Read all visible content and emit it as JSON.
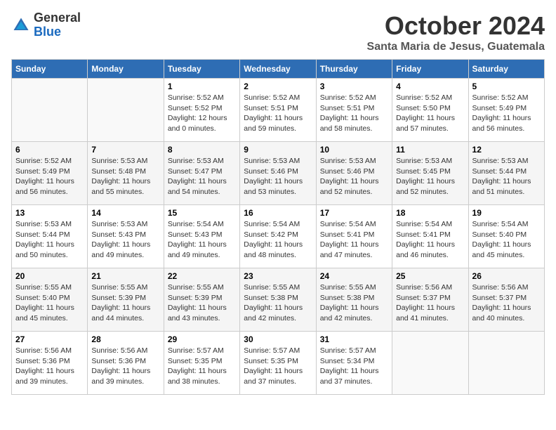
{
  "logo": {
    "general": "General",
    "blue": "Blue"
  },
  "title": "October 2024",
  "location": "Santa Maria de Jesus, Guatemala",
  "weekdays": [
    "Sunday",
    "Monday",
    "Tuesday",
    "Wednesday",
    "Thursday",
    "Friday",
    "Saturday"
  ],
  "weeks": [
    [
      {
        "day": "",
        "info": ""
      },
      {
        "day": "",
        "info": ""
      },
      {
        "day": "1",
        "info": "Sunrise: 5:52 AM\nSunset: 5:52 PM\nDaylight: 12 hours\nand 0 minutes."
      },
      {
        "day": "2",
        "info": "Sunrise: 5:52 AM\nSunset: 5:51 PM\nDaylight: 11 hours\nand 59 minutes."
      },
      {
        "day": "3",
        "info": "Sunrise: 5:52 AM\nSunset: 5:51 PM\nDaylight: 11 hours\nand 58 minutes."
      },
      {
        "day": "4",
        "info": "Sunrise: 5:52 AM\nSunset: 5:50 PM\nDaylight: 11 hours\nand 57 minutes."
      },
      {
        "day": "5",
        "info": "Sunrise: 5:52 AM\nSunset: 5:49 PM\nDaylight: 11 hours\nand 56 minutes."
      }
    ],
    [
      {
        "day": "6",
        "info": "Sunrise: 5:52 AM\nSunset: 5:49 PM\nDaylight: 11 hours\nand 56 minutes."
      },
      {
        "day": "7",
        "info": "Sunrise: 5:53 AM\nSunset: 5:48 PM\nDaylight: 11 hours\nand 55 minutes."
      },
      {
        "day": "8",
        "info": "Sunrise: 5:53 AM\nSunset: 5:47 PM\nDaylight: 11 hours\nand 54 minutes."
      },
      {
        "day": "9",
        "info": "Sunrise: 5:53 AM\nSunset: 5:46 PM\nDaylight: 11 hours\nand 53 minutes."
      },
      {
        "day": "10",
        "info": "Sunrise: 5:53 AM\nSunset: 5:46 PM\nDaylight: 11 hours\nand 52 minutes."
      },
      {
        "day": "11",
        "info": "Sunrise: 5:53 AM\nSunset: 5:45 PM\nDaylight: 11 hours\nand 52 minutes."
      },
      {
        "day": "12",
        "info": "Sunrise: 5:53 AM\nSunset: 5:44 PM\nDaylight: 11 hours\nand 51 minutes."
      }
    ],
    [
      {
        "day": "13",
        "info": "Sunrise: 5:53 AM\nSunset: 5:44 PM\nDaylight: 11 hours\nand 50 minutes."
      },
      {
        "day": "14",
        "info": "Sunrise: 5:53 AM\nSunset: 5:43 PM\nDaylight: 11 hours\nand 49 minutes."
      },
      {
        "day": "15",
        "info": "Sunrise: 5:54 AM\nSunset: 5:43 PM\nDaylight: 11 hours\nand 49 minutes."
      },
      {
        "day": "16",
        "info": "Sunrise: 5:54 AM\nSunset: 5:42 PM\nDaylight: 11 hours\nand 48 minutes."
      },
      {
        "day": "17",
        "info": "Sunrise: 5:54 AM\nSunset: 5:41 PM\nDaylight: 11 hours\nand 47 minutes."
      },
      {
        "day": "18",
        "info": "Sunrise: 5:54 AM\nSunset: 5:41 PM\nDaylight: 11 hours\nand 46 minutes."
      },
      {
        "day": "19",
        "info": "Sunrise: 5:54 AM\nSunset: 5:40 PM\nDaylight: 11 hours\nand 45 minutes."
      }
    ],
    [
      {
        "day": "20",
        "info": "Sunrise: 5:55 AM\nSunset: 5:40 PM\nDaylight: 11 hours\nand 45 minutes."
      },
      {
        "day": "21",
        "info": "Sunrise: 5:55 AM\nSunset: 5:39 PM\nDaylight: 11 hours\nand 44 minutes."
      },
      {
        "day": "22",
        "info": "Sunrise: 5:55 AM\nSunset: 5:39 PM\nDaylight: 11 hours\nand 43 minutes."
      },
      {
        "day": "23",
        "info": "Sunrise: 5:55 AM\nSunset: 5:38 PM\nDaylight: 11 hours\nand 42 minutes."
      },
      {
        "day": "24",
        "info": "Sunrise: 5:55 AM\nSunset: 5:38 PM\nDaylight: 11 hours\nand 42 minutes."
      },
      {
        "day": "25",
        "info": "Sunrise: 5:56 AM\nSunset: 5:37 PM\nDaylight: 11 hours\nand 41 minutes."
      },
      {
        "day": "26",
        "info": "Sunrise: 5:56 AM\nSunset: 5:37 PM\nDaylight: 11 hours\nand 40 minutes."
      }
    ],
    [
      {
        "day": "27",
        "info": "Sunrise: 5:56 AM\nSunset: 5:36 PM\nDaylight: 11 hours\nand 39 minutes."
      },
      {
        "day": "28",
        "info": "Sunrise: 5:56 AM\nSunset: 5:36 PM\nDaylight: 11 hours\nand 39 minutes."
      },
      {
        "day": "29",
        "info": "Sunrise: 5:57 AM\nSunset: 5:35 PM\nDaylight: 11 hours\nand 38 minutes."
      },
      {
        "day": "30",
        "info": "Sunrise: 5:57 AM\nSunset: 5:35 PM\nDaylight: 11 hours\nand 37 minutes."
      },
      {
        "day": "31",
        "info": "Sunrise: 5:57 AM\nSunset: 5:34 PM\nDaylight: 11 hours\nand 37 minutes."
      },
      {
        "day": "",
        "info": ""
      },
      {
        "day": "",
        "info": ""
      }
    ]
  ]
}
